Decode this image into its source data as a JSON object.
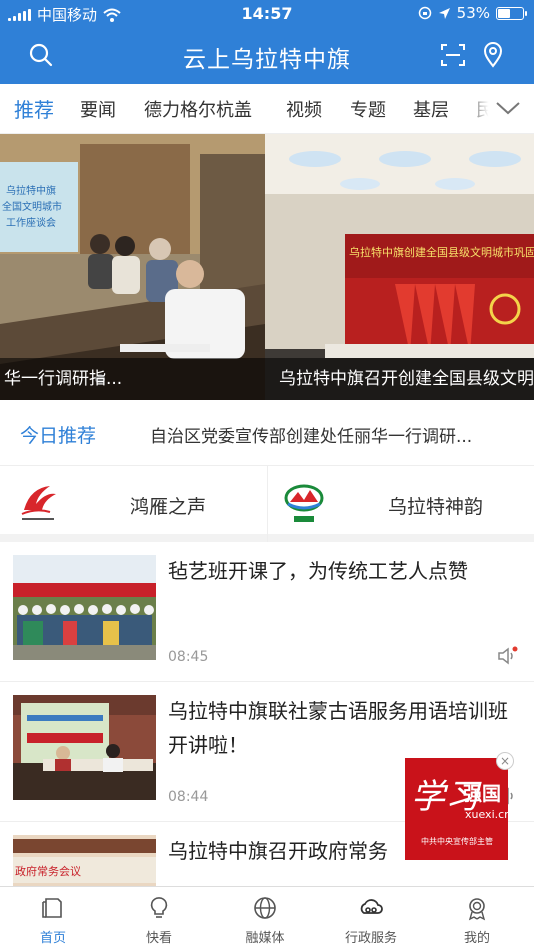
{
  "status_bar": {
    "carrier": "中国移动",
    "time": "14:57",
    "battery": "53%",
    "battery_level": 0.53
  },
  "header": {
    "title": "云上乌拉特中旗",
    "search_icon": "search-icon",
    "scan_icon": "scan-icon",
    "location_icon": "location-pin-icon"
  },
  "tabs": {
    "items": [
      "推荐",
      "要闻",
      "德力格尔杭盖",
      "视频",
      "专题",
      "基层",
      "民"
    ],
    "active": "推荐",
    "more_icon": "chevron-down-icon"
  },
  "banner": {
    "slides": [
      {
        "caption": "华一行调研指...",
        "screen_text": "乌拉特中旗\n全国文明城市\n工作座谈会"
      },
      {
        "caption": "乌拉特中旗召开创建全国县级文明城市巩固提升",
        "banner_text": "乌拉特中旗创建全国县级文明城市巩固"
      }
    ]
  },
  "today": {
    "label": "今日推荐",
    "text": "自治区党委宣传部创建处任丽华一行调研..."
  },
  "channels": [
    {
      "name": "鸿雁之声",
      "logo": "swan-logo"
    },
    {
      "name": "乌拉特神韵",
      "logo": "urad-logo"
    }
  ],
  "news": [
    {
      "title": "毡艺班开课了，为传统工艺人点赞",
      "time": "08:45",
      "has_audio": true
    },
    {
      "title": "乌拉特中旗联社蒙古语服务用语培训班开讲啦！",
      "time": "08:44",
      "has_audio": true
    },
    {
      "title": "乌拉特中旗召开政府常务",
      "thumb_text": "政府常务会议",
      "time": ""
    }
  ],
  "xuexi": {
    "calligraphy": "学习",
    "brand": "强国",
    "domain": "xuexi.cn",
    "org": "中共中央宣传部主管"
  },
  "bottom_nav": [
    {
      "label": "首页",
      "icon": "home-icon"
    },
    {
      "label": "快看",
      "icon": "lightbulb-icon"
    },
    {
      "label": "融媒体",
      "icon": "globe-icon"
    },
    {
      "label": "行政服务",
      "icon": "cloud-link-icon"
    },
    {
      "label": "我的",
      "icon": "award-icon"
    }
  ],
  "colors": {
    "brand_blue": "#2f80d7",
    "xuexi_red": "#c9121a"
  }
}
